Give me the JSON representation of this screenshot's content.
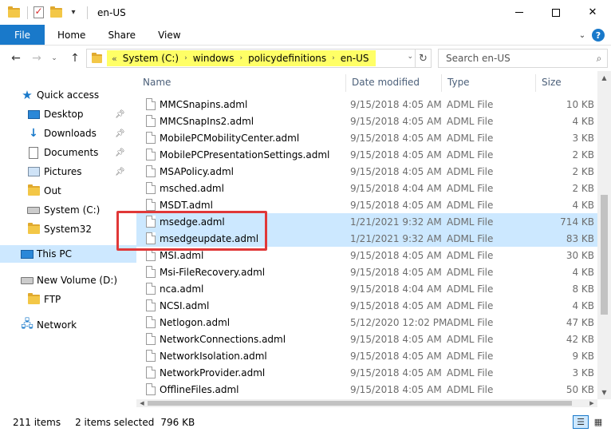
{
  "window": {
    "title": "en-US"
  },
  "ribbon": {
    "tabs": [
      "File",
      "Home",
      "Share",
      "View"
    ],
    "expand_icon": "chevron-down-icon",
    "help_label": "?"
  },
  "address": {
    "overflow": "«",
    "crumbs": [
      "System (C:)",
      "windows",
      "policydefinitions",
      "en-US"
    ],
    "highlight_color": "#ffff66"
  },
  "search": {
    "placeholder": "Search en-US"
  },
  "sidebar": {
    "items": [
      {
        "label": "Quick access",
        "icon": "star-icon"
      },
      {
        "label": "Desktop",
        "icon": "desktop-icon",
        "pinned": true
      },
      {
        "label": "Downloads",
        "icon": "download-icon",
        "pinned": true
      },
      {
        "label": "Documents",
        "icon": "documents-icon",
        "pinned": true
      },
      {
        "label": "Pictures",
        "icon": "pictures-icon",
        "pinned": true
      },
      {
        "label": "Out",
        "icon": "folder-icon"
      },
      {
        "label": "System (C:)",
        "icon": "drive-icon"
      },
      {
        "label": "System32",
        "icon": "folder-icon"
      },
      {
        "label": "This PC",
        "icon": "computer-icon",
        "selected": true
      },
      {
        "label": "New Volume (D:)",
        "icon": "drive-icon"
      },
      {
        "label": "FTP",
        "icon": "folder-icon"
      },
      {
        "label": "Network",
        "icon": "network-icon"
      }
    ]
  },
  "columns": {
    "name": "Name",
    "date": "Date modified",
    "type": "Type",
    "size": "Size"
  },
  "files": [
    {
      "name": "MMCSnapins.adml",
      "date": "9/15/2018 4:05 AM",
      "type": "ADML File",
      "size": "10 KB"
    },
    {
      "name": "MMCSnapIns2.adml",
      "date": "9/15/2018 4:05 AM",
      "type": "ADML File",
      "size": "4 KB"
    },
    {
      "name": "MobilePCMobilityCenter.adml",
      "date": "9/15/2018 4:05 AM",
      "type": "ADML File",
      "size": "3 KB"
    },
    {
      "name": "MobilePCPresentationSettings.adml",
      "date": "9/15/2018 4:05 AM",
      "type": "ADML File",
      "size": "2 KB"
    },
    {
      "name": "MSAPolicy.adml",
      "date": "9/15/2018 4:05 AM",
      "type": "ADML File",
      "size": "2 KB"
    },
    {
      "name": "msched.adml",
      "date": "9/15/2018 4:04 AM",
      "type": "ADML File",
      "size": "2 KB"
    },
    {
      "name": "MSDT.adml",
      "date": "9/15/2018 4:05 AM",
      "type": "ADML File",
      "size": "4 KB"
    },
    {
      "name": "msedge.adml",
      "date": "1/21/2021 9:32 AM",
      "type": "ADML File",
      "size": "714 KB",
      "selected": true
    },
    {
      "name": "msedgeupdate.adml",
      "date": "1/21/2021 9:32 AM",
      "type": "ADML File",
      "size": "83 KB",
      "selected": true
    },
    {
      "name": "MSI.adml",
      "date": "9/15/2018 4:05 AM",
      "type": "ADML File",
      "size": "30 KB"
    },
    {
      "name": "Msi-FileRecovery.adml",
      "date": "9/15/2018 4:05 AM",
      "type": "ADML File",
      "size": "4 KB"
    },
    {
      "name": "nca.adml",
      "date": "9/15/2018 4:04 AM",
      "type": "ADML File",
      "size": "8 KB"
    },
    {
      "name": "NCSI.adml",
      "date": "9/15/2018 4:05 AM",
      "type": "ADML File",
      "size": "4 KB"
    },
    {
      "name": "Netlogon.adml",
      "date": "5/12/2020 12:02 PM",
      "type": "ADML File",
      "size": "47 KB"
    },
    {
      "name": "NetworkConnections.adml",
      "date": "9/15/2018 4:05 AM",
      "type": "ADML File",
      "size": "42 KB"
    },
    {
      "name": "NetworkIsolation.adml",
      "date": "9/15/2018 4:05 AM",
      "type": "ADML File",
      "size": "9 KB"
    },
    {
      "name": "NetworkProvider.adml",
      "date": "9/15/2018 4:05 AM",
      "type": "ADML File",
      "size": "3 KB"
    },
    {
      "name": "OfflineFiles.adml",
      "date": "9/15/2018 4:05 AM",
      "type": "ADML File",
      "size": "50 KB"
    }
  ],
  "status": {
    "count": "211 items",
    "selected": "2 items selected",
    "selected_size": "796 KB"
  },
  "colors": {
    "accent": "#1979ca",
    "selection": "#cce8ff",
    "annotation_box": "#e03838"
  }
}
